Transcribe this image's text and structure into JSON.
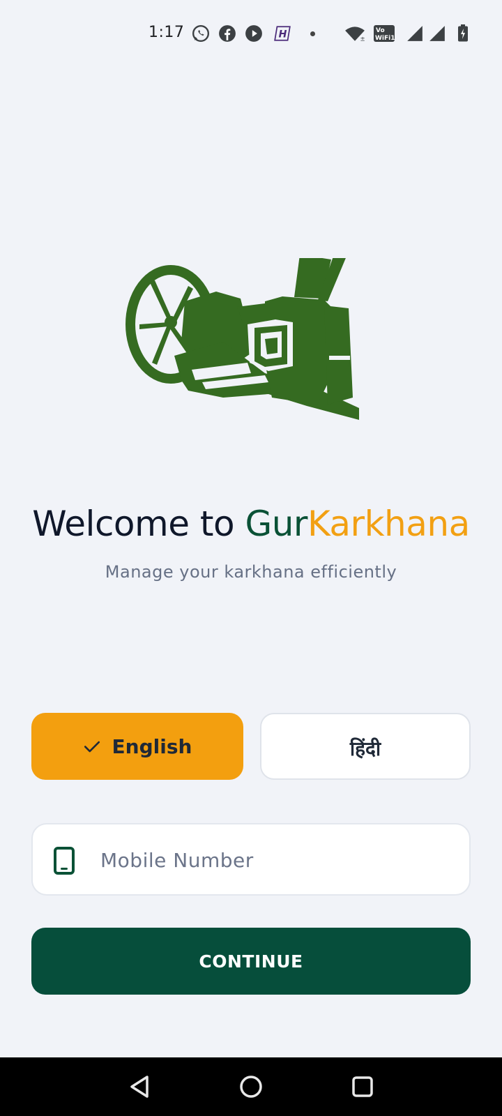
{
  "status_bar": {
    "time": "1:17",
    "icons": [
      "whatsapp-icon",
      "facebook-icon",
      "youtube-icon",
      "hotstar-icon",
      "notification-dot",
      "wifi-icon",
      "vowifi-icon",
      "signal-icon",
      "signal-icon",
      "battery-charging-icon"
    ]
  },
  "welcome": {
    "prefix": "Welcome to ",
    "brand_part1": "Gur",
    "brand_part2": "Karkhana",
    "tagline": "Manage your karkhana efficiently"
  },
  "language": {
    "english_label": "English",
    "hindi_label": "हिंदी",
    "selected": "English"
  },
  "mobile": {
    "placeholder": "Mobile Number",
    "value": ""
  },
  "continue_label": "CONTINUE",
  "colors": {
    "background": "#f1f3f8",
    "primary_green": "#064e3b",
    "brand_green": "#0a5136",
    "accent_orange": "#f39f0f",
    "illustration_green": "#356b21"
  },
  "nav": {
    "icons": [
      "back-icon",
      "home-icon",
      "recents-icon"
    ]
  }
}
